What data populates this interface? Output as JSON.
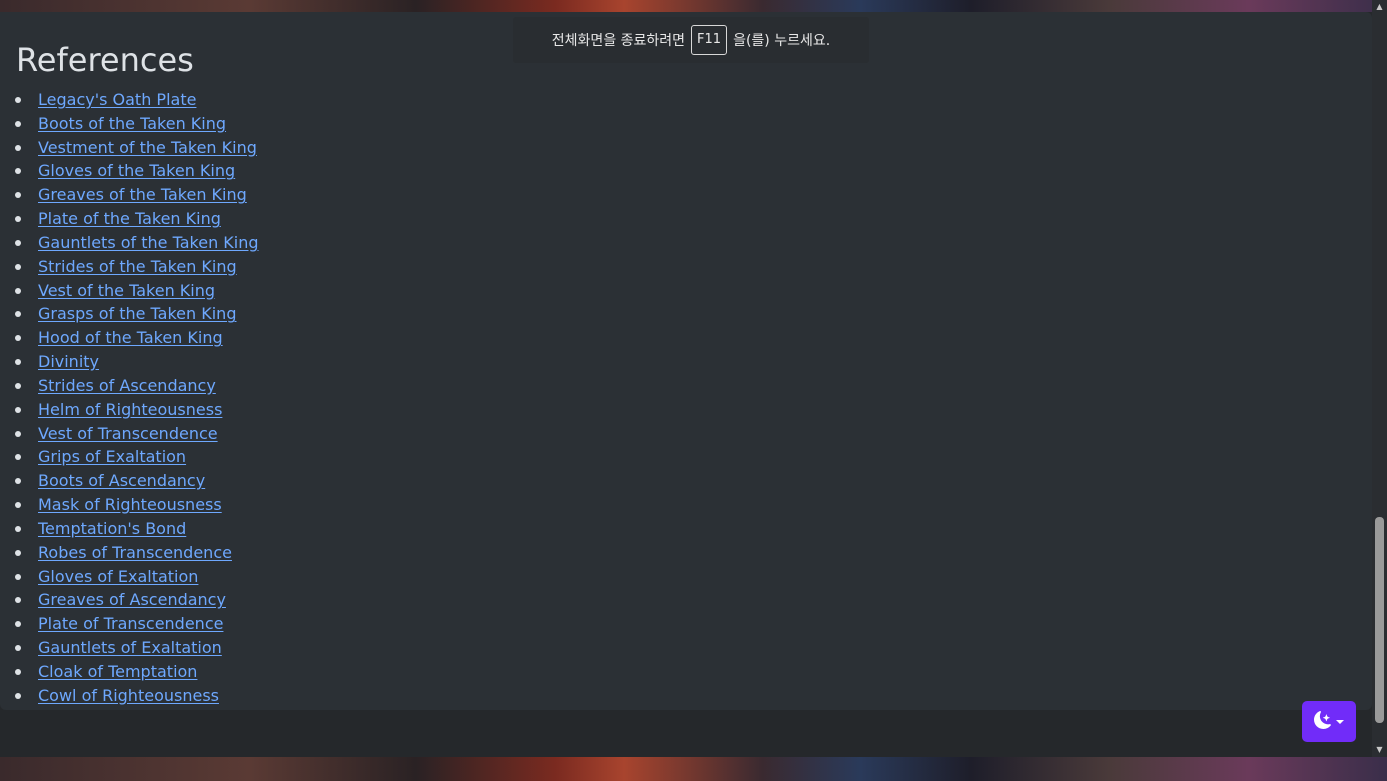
{
  "references": {
    "heading": "References",
    "items": [
      "Legacy's Oath Plate",
      "Boots of the Taken King",
      "Vestment of the Taken King",
      "Gloves of the Taken King",
      "Greaves of the Taken King",
      "Plate of the Taken King",
      "Gauntlets of the Taken King",
      "Strides of the Taken King",
      "Vest of the Taken King",
      "Grasps of the Taken King",
      "Hood of the Taken King",
      "Divinity",
      "Strides of Ascendancy",
      "Helm of Righteousness",
      "Vest of Transcendence",
      "Grips of Exaltation",
      "Boots of Ascendancy",
      "Mask of Righteousness",
      "Temptation's Bond",
      "Robes of Transcendence",
      "Gloves of Exaltation",
      "Greaves of Ascendancy",
      "Plate of Transcendence",
      "Gauntlets of Exaltation",
      "Cloak of Temptation",
      "Cowl of Righteousness"
    ]
  },
  "fullscreen_notice": {
    "before_key": "전체화면을 종료하려면",
    "key": "F11",
    "after_key": "을(를) 누르세요."
  },
  "theme_toggle": {
    "icon": "moon-stars-icon",
    "color": "#712cf9"
  },
  "colors": {
    "link": "#6ea8fe",
    "card_bg": "#2b3035",
    "text": "#dee2e6"
  }
}
